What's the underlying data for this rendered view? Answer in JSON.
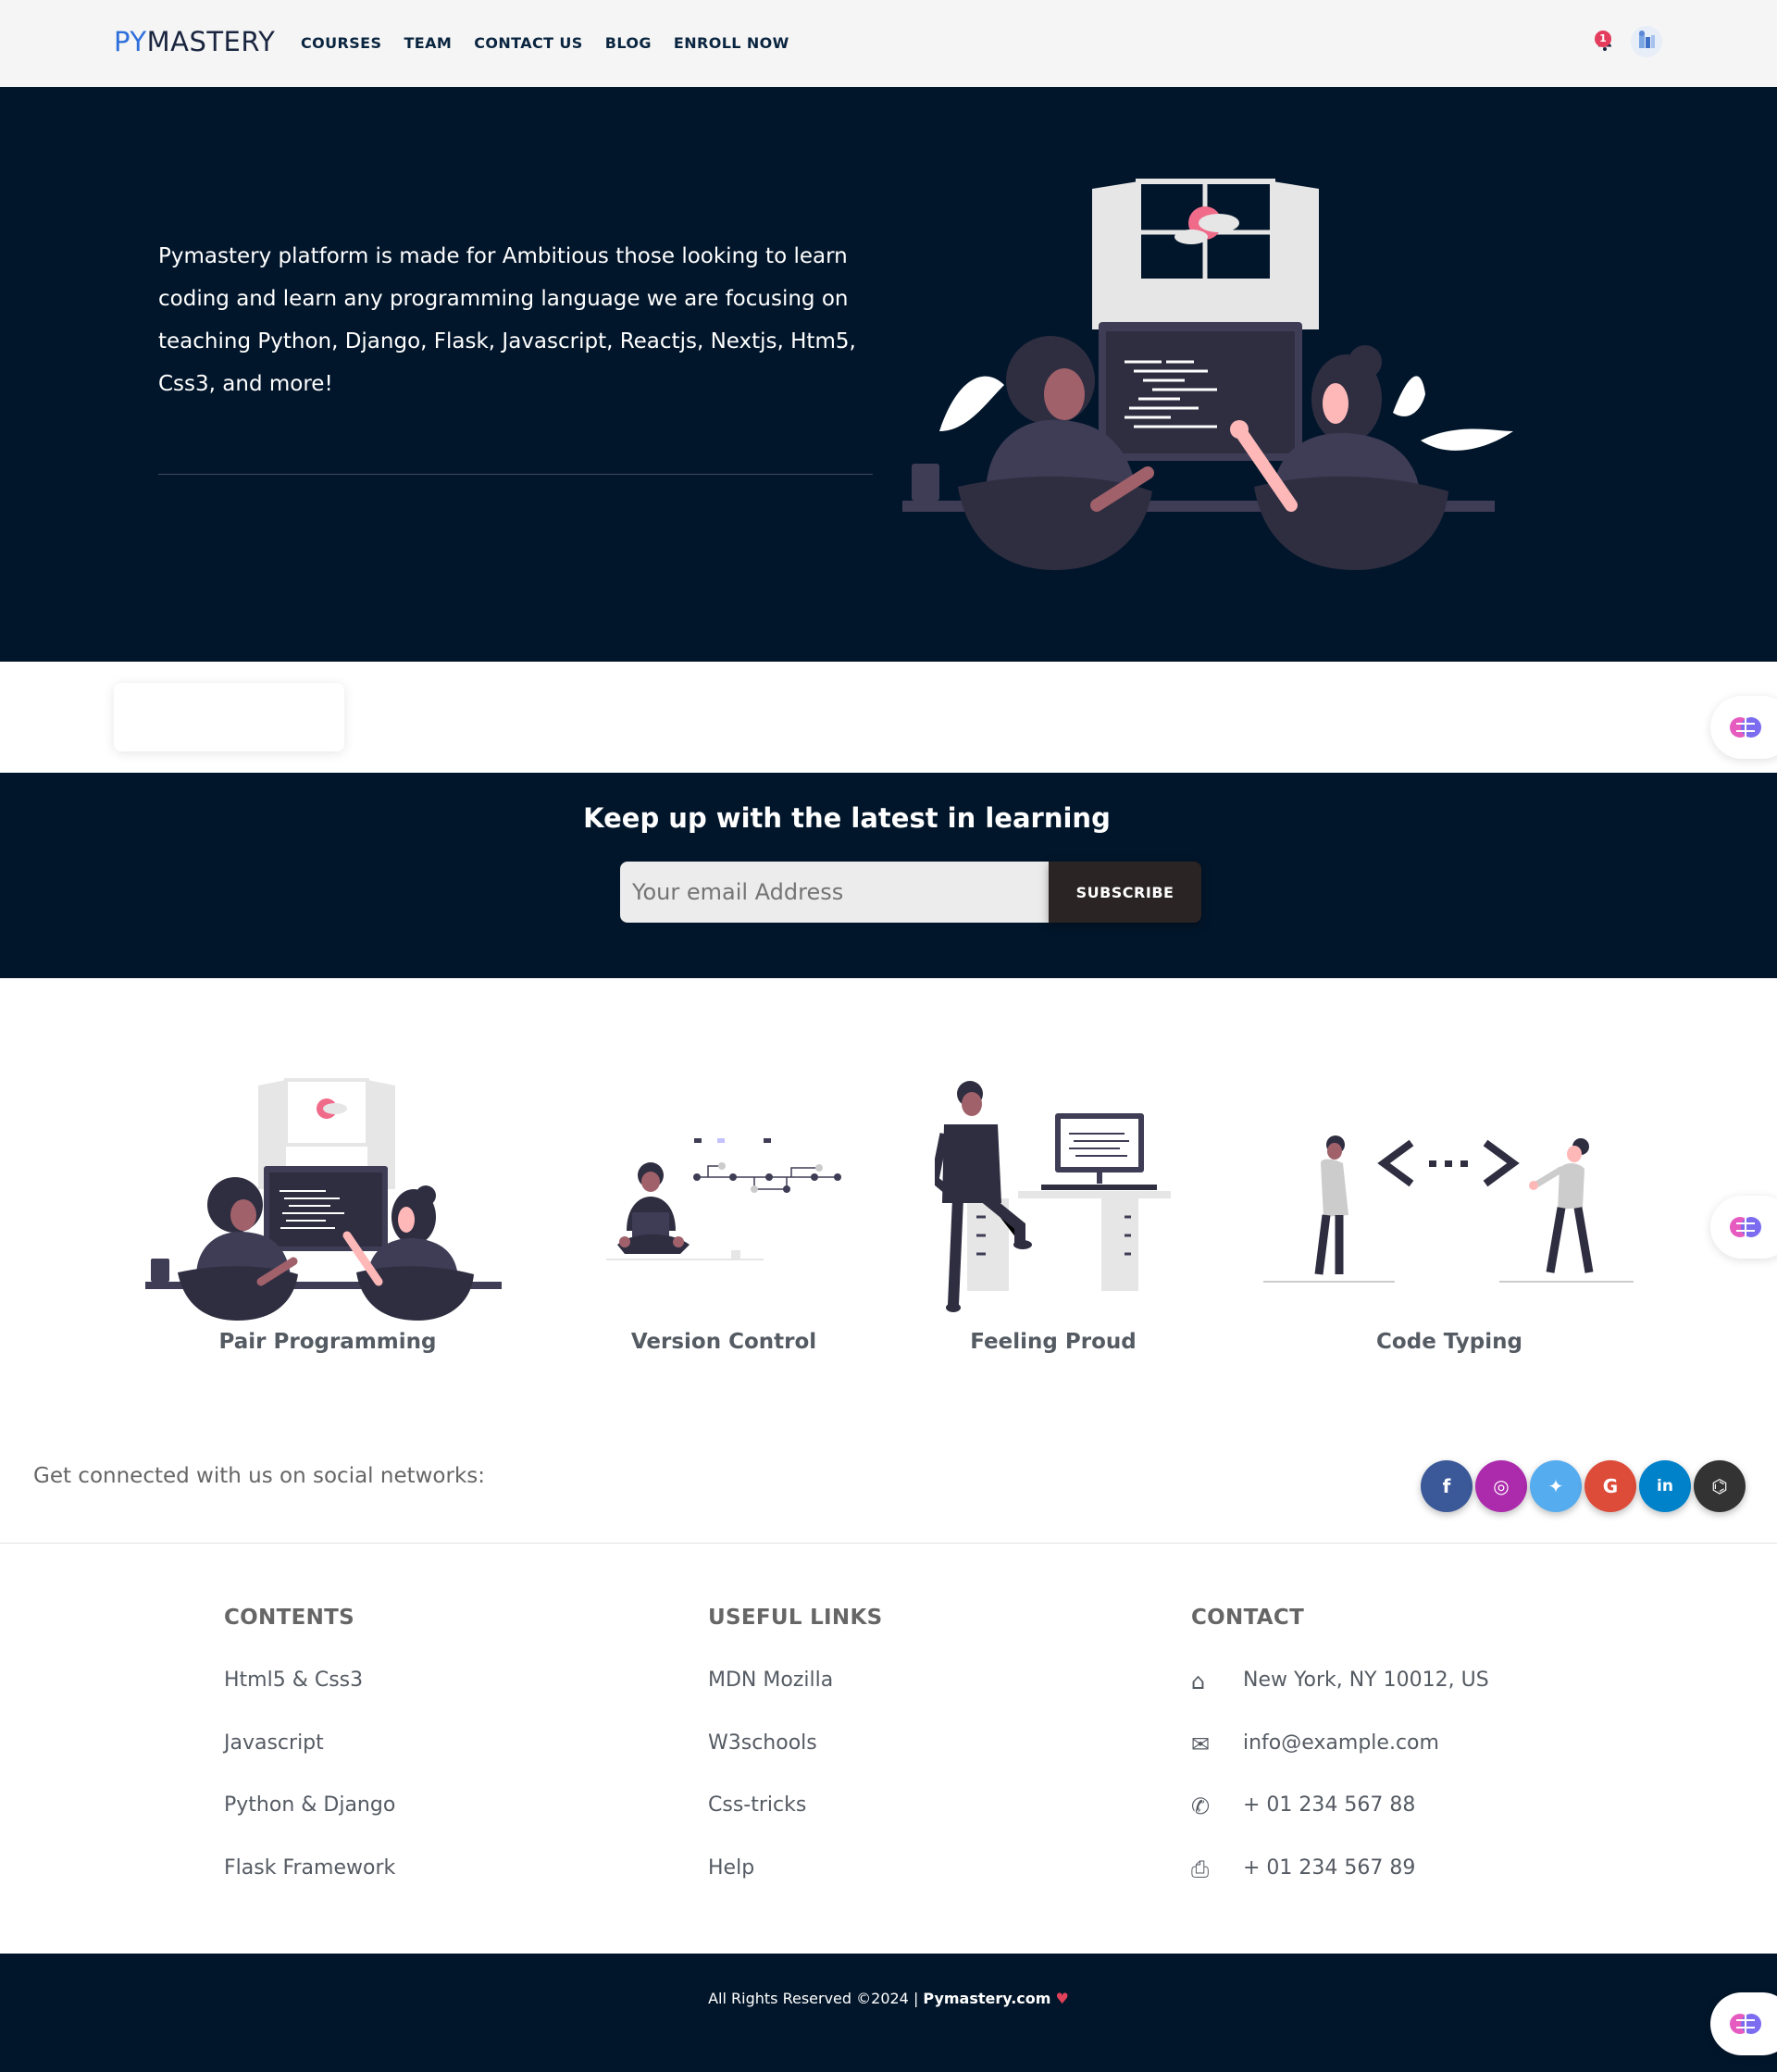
{
  "nav": {
    "logo_prefix": "PY",
    "logo_suffix": "MASTERY",
    "links": [
      "COURSES",
      "TEAM",
      "CONTACT US",
      "BLOG",
      "ENROLL NOW"
    ],
    "notification_count": "1"
  },
  "hero": {
    "text": "Pymastery platform is made for Ambitious those looking to learn coding and learn any programming language we are focusing on teaching Python, Django, Flask, Javascript, Reactjs, Nextjs, Htm5, Css3, and more!"
  },
  "subscribe": {
    "title": "Keep up with the latest in learning",
    "placeholder": "Your email Address",
    "button": "SUBSCRIBE"
  },
  "features": [
    {
      "label": "Pair Programming",
      "icon": "pair-programming-illustration"
    },
    {
      "label": "Version Control",
      "icon": "version-control-illustration"
    },
    {
      "label": "Feeling Proud",
      "icon": "feeling-proud-illustration"
    },
    {
      "label": "Code Typing",
      "icon": "code-typing-illustration"
    }
  ],
  "social": {
    "text": "Get connected with us on social networks:",
    "networks": [
      {
        "name": "facebook",
        "glyph": "f",
        "color": "#3b5998"
      },
      {
        "name": "instagram",
        "glyph": "◎",
        "color": "#ac2bac"
      },
      {
        "name": "twitter",
        "glyph": "✦",
        "color": "#55acee"
      },
      {
        "name": "google",
        "glyph": "G",
        "color": "#dd4b39"
      },
      {
        "name": "linkedin",
        "glyph": "in",
        "color": "#0082ca"
      },
      {
        "name": "github",
        "glyph": "⌬",
        "color": "#333333"
      }
    ]
  },
  "footer": {
    "contents_title": "CONTENTS",
    "contents": [
      "Html5 & Css3",
      "Javascript",
      "Python & Django",
      "Flask Framework"
    ],
    "links_title": "USEFUL LINKS",
    "links": [
      "MDN Mozilla",
      "W3schools",
      "Css-tricks",
      "Help"
    ],
    "contact_title": "CONTACT",
    "contact": [
      {
        "icon": "home-icon",
        "text": "New York, NY 10012, US"
      },
      {
        "icon": "envelope-icon",
        "text": "info@example.com"
      },
      {
        "icon": "phone-icon",
        "text": "+ 01 234 567 88"
      },
      {
        "icon": "printer-icon",
        "text": "+ 01 234 567 89"
      }
    ]
  },
  "copyright": {
    "prefix": "All Rights Reserved ©2024 | ",
    "brand": "Pymastery.com"
  },
  "colors": {
    "dark": "#02162b",
    "accent": "#2f6fdb",
    "pink": "#f06b8a"
  }
}
